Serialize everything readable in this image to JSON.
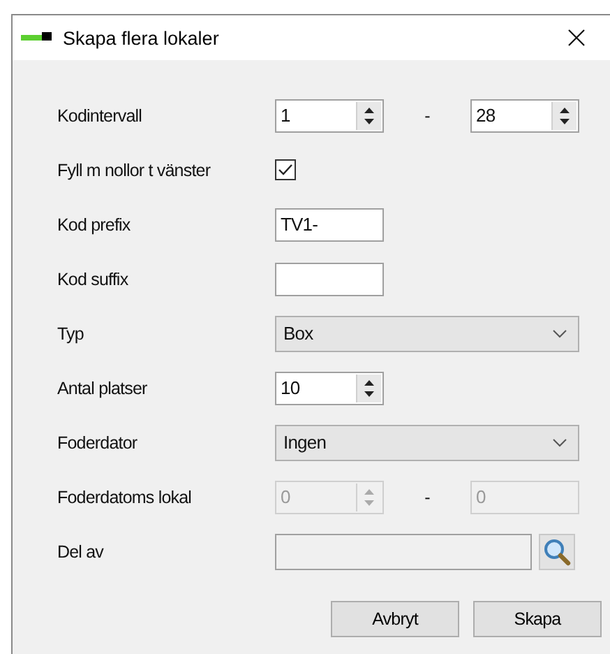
{
  "window": {
    "title": "Skapa flera lokaler"
  },
  "fields": [
    {
      "kind": "range",
      "label": "Kodintervall",
      "from": "1",
      "separator": "-",
      "to": "28",
      "disabled": false
    },
    {
      "kind": "checkbox",
      "label": "Fyll m nollor t vänster",
      "checked": true
    },
    {
      "kind": "text",
      "label": "Kod prefix",
      "value": "TV1-"
    },
    {
      "kind": "text",
      "label": "Kod suffix"
    },
    {
      "kind": "combo",
      "label": "Typ",
      "value": "Box"
    },
    {
      "kind": "spin",
      "label": "Antal platser",
      "value": "10"
    },
    {
      "kind": "combo",
      "label": "Foderdator",
      "value": "Ingen"
    },
    {
      "kind": "range",
      "label": "Foderdatoms lokal",
      "from": "0",
      "separator": "-",
      "to": "0",
      "disabled": true
    },
    {
      "kind": "lookup",
      "label": "Del av"
    }
  ],
  "buttons": [
    "Avbryt",
    "Skapa"
  ]
}
